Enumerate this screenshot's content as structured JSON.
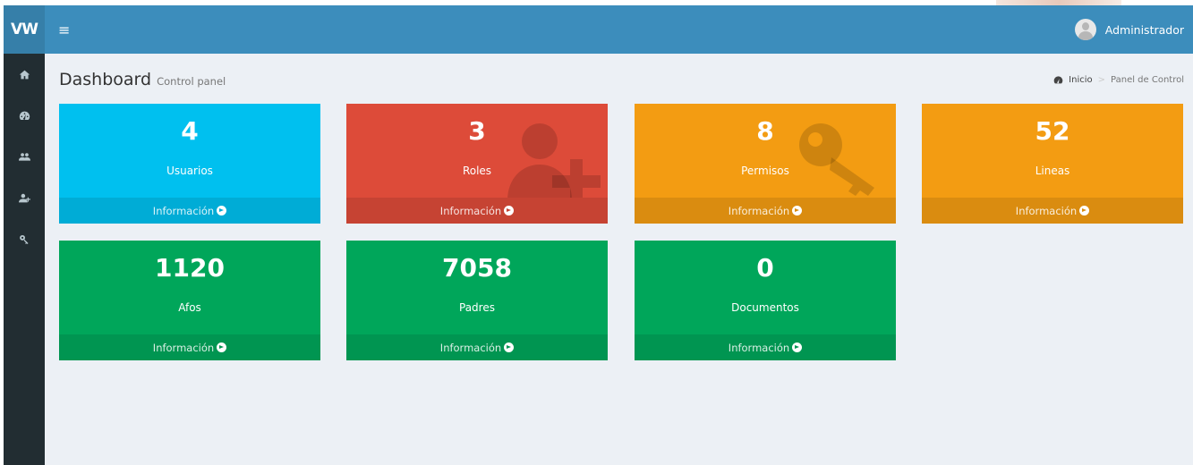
{
  "header": {
    "logo": "VW",
    "menu_toggle": "≡",
    "user_name": "Administrador"
  },
  "sidebar": {
    "items": [
      {
        "icon": "home-icon"
      },
      {
        "icon": "dashboard-icon"
      },
      {
        "icon": "users-icon"
      },
      {
        "icon": "user-plus-icon"
      },
      {
        "icon": "key-icon"
      }
    ]
  },
  "page": {
    "title": "Dashboard",
    "subtitle": "Control panel",
    "breadcrumb": {
      "home": "Inicio",
      "current": "Panel de Control"
    }
  },
  "boxes": [
    {
      "value": "4",
      "label": "Usuarios",
      "footer": "Información",
      "color": "#00c0ef"
    },
    {
      "value": "3",
      "label": "Roles",
      "footer": "Información",
      "color": "#dd4b39",
      "icon": "user-plus-icon"
    },
    {
      "value": "8",
      "label": "Permisos",
      "footer": "Información",
      "color": "#f39c12",
      "icon": "key-icon"
    },
    {
      "value": "52",
      "label": "Lineas",
      "footer": "Información",
      "color": "#f39c12"
    },
    {
      "value": "1120",
      "label": "Afos",
      "footer": "Información",
      "color": "#00a65a"
    },
    {
      "value": "7058",
      "label": "Padres",
      "footer": "Información",
      "color": "#00a65a"
    },
    {
      "value": "0",
      "label": "Documentos",
      "footer": "Información",
      "color": "#00a65a"
    }
  ]
}
